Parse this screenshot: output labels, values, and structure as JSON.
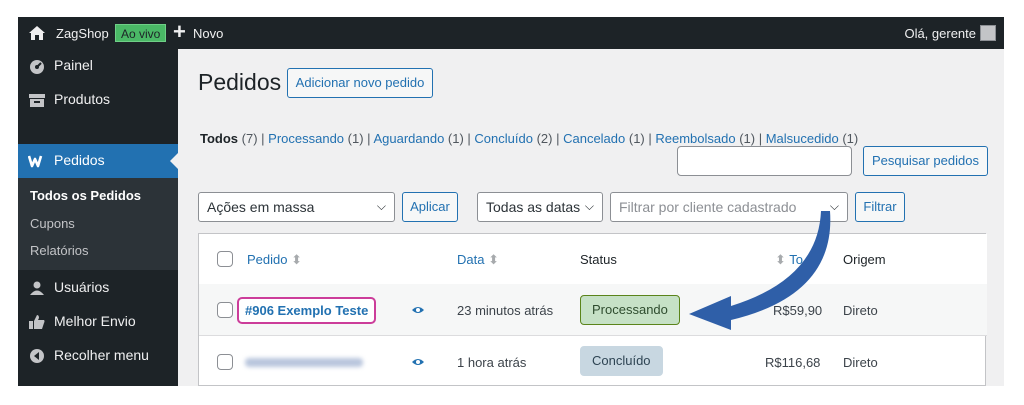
{
  "adminbar": {
    "site_name": "ZagShop",
    "live_badge": "Ao vivo",
    "new_label": "Novo",
    "greeting": "Olá, gerente"
  },
  "sidebar": {
    "items": [
      {
        "label": "Painel",
        "icon": "dashboard-icon"
      },
      {
        "label": "Produtos",
        "icon": "archive-icon"
      },
      {
        "label": "Pedidos",
        "icon": "woo-icon"
      },
      {
        "label": "Usuários",
        "icon": "users-icon"
      },
      {
        "label": "Melhor Envio",
        "icon": "thumbs-up-icon"
      },
      {
        "label": "Recolher menu",
        "icon": "collapse-icon"
      }
    ],
    "submenu": [
      "Todos os Pedidos",
      "Cupons",
      "Relatórios"
    ]
  },
  "page": {
    "title": "Pedidos",
    "add_button": "Adicionar novo pedido",
    "views": [
      {
        "label": "Todos",
        "count": "(7)"
      },
      {
        "label": "Processando",
        "count": "(1)"
      },
      {
        "label": "Aguardando",
        "count": "(1)"
      },
      {
        "label": "Concluído",
        "count": "(2)"
      },
      {
        "label": "Cancelado",
        "count": "(1)"
      },
      {
        "label": "Reembolsado",
        "count": "(1)"
      },
      {
        "label": "Malsucedido",
        "count": "(1)"
      }
    ],
    "search_button": "Pesquisar pedidos",
    "bulk_actions": "Ações em massa",
    "apply_button": "Aplicar",
    "dates_filter": "Todas as datas",
    "customer_filter_placeholder": "Filtrar por cliente cadastrado",
    "filter_button": "Filtrar"
  },
  "table": {
    "columns": {
      "order": "Pedido",
      "date": "Data",
      "status": "Status",
      "total": "To",
      "origin": "Origem"
    },
    "rows": [
      {
        "order": "#906 Exemplo Teste",
        "date": "23 minutos atrás",
        "status": "Processando",
        "total": "R$59,90",
        "origin": "Direto"
      },
      {
        "order": "",
        "date": "1 hora atrás",
        "status": "Concluído",
        "total": "R$116,68",
        "origin": "Direto"
      }
    ]
  },
  "colors": {
    "accent": "#2271b1",
    "highlight_border": "#cc3d9a",
    "arrow": "#2f5fa8",
    "processing": "#c6e1c6",
    "completed": "#c8d7e1"
  }
}
